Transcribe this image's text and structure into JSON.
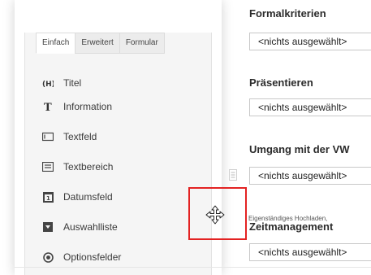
{
  "tabs": {
    "simple": "Einfach",
    "advanced": "Erweitert",
    "form": "Formular"
  },
  "field_types": [
    {
      "label": "Titel",
      "icon": "heading-icon"
    },
    {
      "label": "Information",
      "icon": "text-t-icon"
    },
    {
      "label": "Textfeld",
      "icon": "textfield-icon"
    },
    {
      "label": "Textbereich",
      "icon": "textarea-icon"
    },
    {
      "label": "Datumsfeld",
      "icon": "calendar-icon"
    },
    {
      "label": "Auswahlliste",
      "icon": "dropdown-icon"
    },
    {
      "label": "Optionsfelder",
      "icon": "radio-icon"
    }
  ],
  "form": {
    "sections": [
      {
        "title": "Formalkriterien",
        "select": "<nichts ausgewählt>"
      },
      {
        "title": "Präsentieren",
        "select": "<nichts ausgewählt>"
      },
      {
        "title": "Umgang mit der VW",
        "select": "<nichts ausgewählt>"
      },
      {
        "title": "Zeitmanagement",
        "select": "<nichts ausgewählt>"
      }
    ],
    "helper_text": "Eigenständiges Hochladen,"
  },
  "colors": {
    "highlight": "#e32222",
    "panel_bg": "#f5f5f5"
  }
}
